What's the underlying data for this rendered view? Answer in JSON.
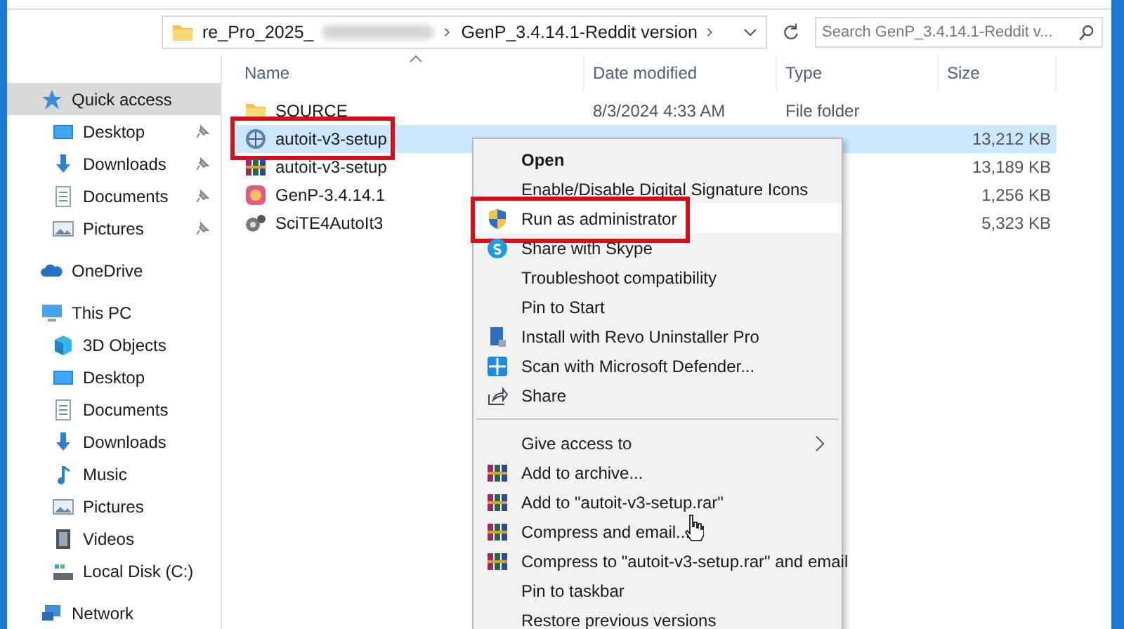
{
  "address_bar": {
    "breadcrumbs": [
      {
        "label": "re_Pro_2025_",
        "blurred_tail": true
      },
      {
        "label": "GenP_3.4.14.1-Reddit version",
        "blurred_tail": false
      }
    ]
  },
  "search": {
    "placeholder": "Search GenP_3.4.14.1-Reddit v..."
  },
  "nav_pane": {
    "items": [
      {
        "label": "Quick access",
        "selected": true,
        "children": [
          {
            "label": "Desktop",
            "pinned": true
          },
          {
            "label": "Downloads",
            "pinned": true
          },
          {
            "label": "Documents",
            "pinned": true
          },
          {
            "label": "Pictures",
            "pinned": true
          }
        ]
      },
      {
        "label": "OneDrive",
        "selected": false
      },
      {
        "label": "This PC",
        "selected": false,
        "children": [
          {
            "label": "3D Objects",
            "pinned": false
          },
          {
            "label": "Desktop",
            "pinned": false
          },
          {
            "label": "Documents",
            "pinned": false
          },
          {
            "label": "Downloads",
            "pinned": false
          },
          {
            "label": "Music",
            "pinned": false
          },
          {
            "label": "Pictures",
            "pinned": false
          },
          {
            "label": "Videos",
            "pinned": false
          },
          {
            "label": "Local Disk (C:)",
            "pinned": false
          }
        ]
      },
      {
        "label": "Network",
        "selected": false
      }
    ]
  },
  "columns": [
    "Name",
    "Date modified",
    "Type",
    "Size"
  ],
  "files": [
    {
      "name": "SOURCE",
      "date": "8/3/2024 4:33 AM",
      "type": "File folder",
      "selected": false
    },
    {
      "name": "autoit-v3-setup",
      "size": "13,212 KB",
      "selected": true,
      "annotated": true
    },
    {
      "name": "autoit-v3-setup",
      "size": "13,189 KB",
      "selected": false
    },
    {
      "name": "GenP-3.4.14.1",
      "size": "1,256 KB",
      "selected": false
    },
    {
      "name": "SciTE4AutoIt3",
      "size": "5,323 KB",
      "selected": false
    }
  ],
  "context_menu": {
    "items": [
      {
        "kind": "item",
        "label": "Open",
        "bold": true,
        "hovered": false
      },
      {
        "kind": "item",
        "label": "Enable/Disable Digital Signature Icons",
        "hovered": false
      },
      {
        "kind": "item",
        "label": "Run as administrator",
        "hovered": true,
        "annotated": true
      },
      {
        "kind": "item",
        "label": "Share with Skype",
        "hovered": false
      },
      {
        "kind": "item",
        "label": "Troubleshoot compatibility",
        "hovered": false
      },
      {
        "kind": "item",
        "label": "Pin to Start",
        "hovered": false
      },
      {
        "kind": "item",
        "label": "Install with Revo Uninstaller Pro",
        "hovered": false
      },
      {
        "kind": "item",
        "label": "Scan with Microsoft Defender...",
        "hovered": false
      },
      {
        "kind": "item",
        "label": "Share",
        "hovered": false
      },
      {
        "kind": "separator"
      },
      {
        "kind": "item",
        "label": "Give access to",
        "submenu": true,
        "hovered": false
      },
      {
        "kind": "item",
        "label": "Add to archive...",
        "hovered": false
      },
      {
        "kind": "item",
        "label": "Add to \"autoit-v3-setup.rar\"",
        "hovered": false
      },
      {
        "kind": "item",
        "label": "Compress and email...",
        "hovered": false
      },
      {
        "kind": "item",
        "label": "Compress to \"autoit-v3-setup.rar\" and email",
        "hovered": false
      },
      {
        "kind": "item",
        "label": "Pin to taskbar",
        "hovered": false
      },
      {
        "kind": "item",
        "label": "Restore previous versions",
        "hovered": false
      }
    ]
  }
}
